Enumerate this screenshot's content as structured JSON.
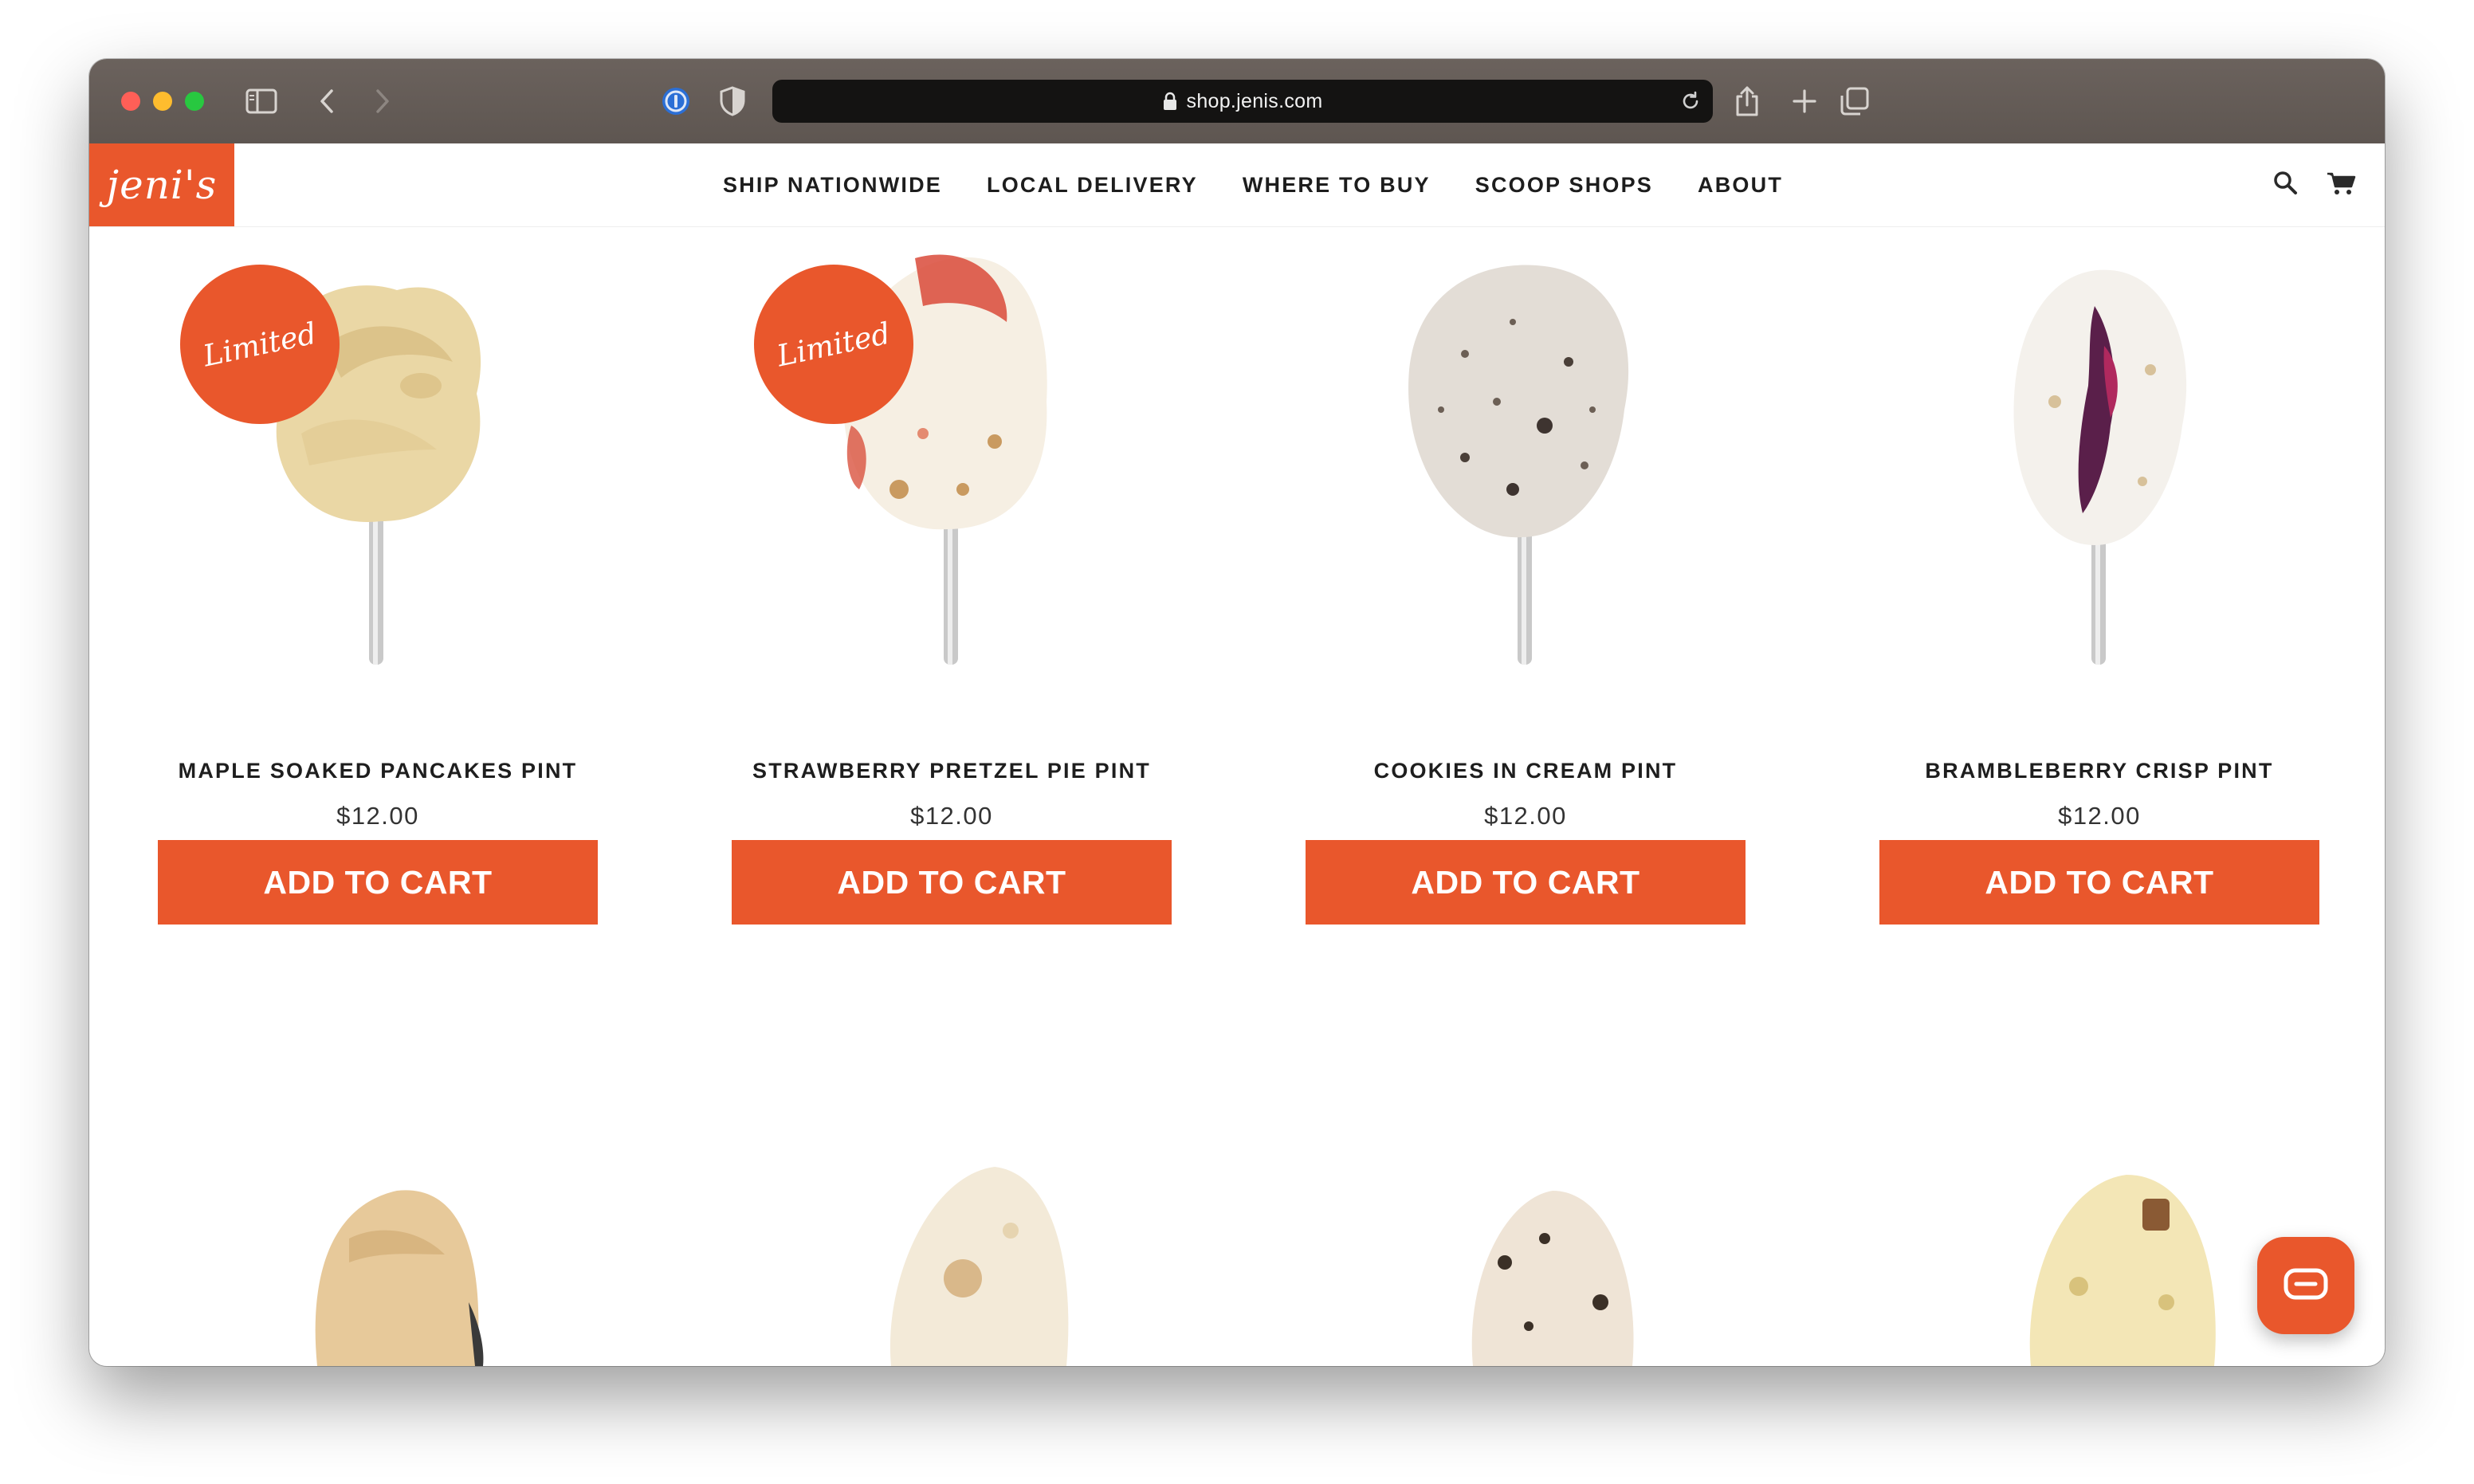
{
  "browser": {
    "url": "shop.jenis.com"
  },
  "site": {
    "logo_text": "jeni's",
    "brand_color": "#e9572c",
    "nav": [
      {
        "label": "SHIP NATIONWIDE"
      },
      {
        "label": "LOCAL DELIVERY"
      },
      {
        "label": "WHERE TO BUY"
      },
      {
        "label": "SCOOP SHOPS"
      },
      {
        "label": "ABOUT"
      }
    ]
  },
  "products": [
    {
      "name": "MAPLE SOAKED PANCAKES PINT",
      "price": "$12.00",
      "button": "ADD TO CART",
      "badge": "Limited"
    },
    {
      "name": "STRAWBERRY PRETZEL PIE PINT",
      "price": "$12.00",
      "button": "ADD TO CART",
      "badge": "Limited"
    },
    {
      "name": "COOKIES IN CREAM PINT",
      "price": "$12.00",
      "button": "ADD TO CART"
    },
    {
      "name": "BRAMBLEBERRY CRISP PINT",
      "price": "$12.00",
      "button": "ADD TO CART"
    }
  ],
  "icons": {
    "header": [
      "search-icon",
      "cart-icon"
    ],
    "chrome": [
      "sidebar-icon",
      "back-icon",
      "forward-icon",
      "password-manager-icon",
      "shield-icon",
      "lock-icon",
      "reload-icon",
      "share-icon",
      "new-tab-icon",
      "tabs-overview-icon"
    ],
    "chat": "chat-icon"
  }
}
